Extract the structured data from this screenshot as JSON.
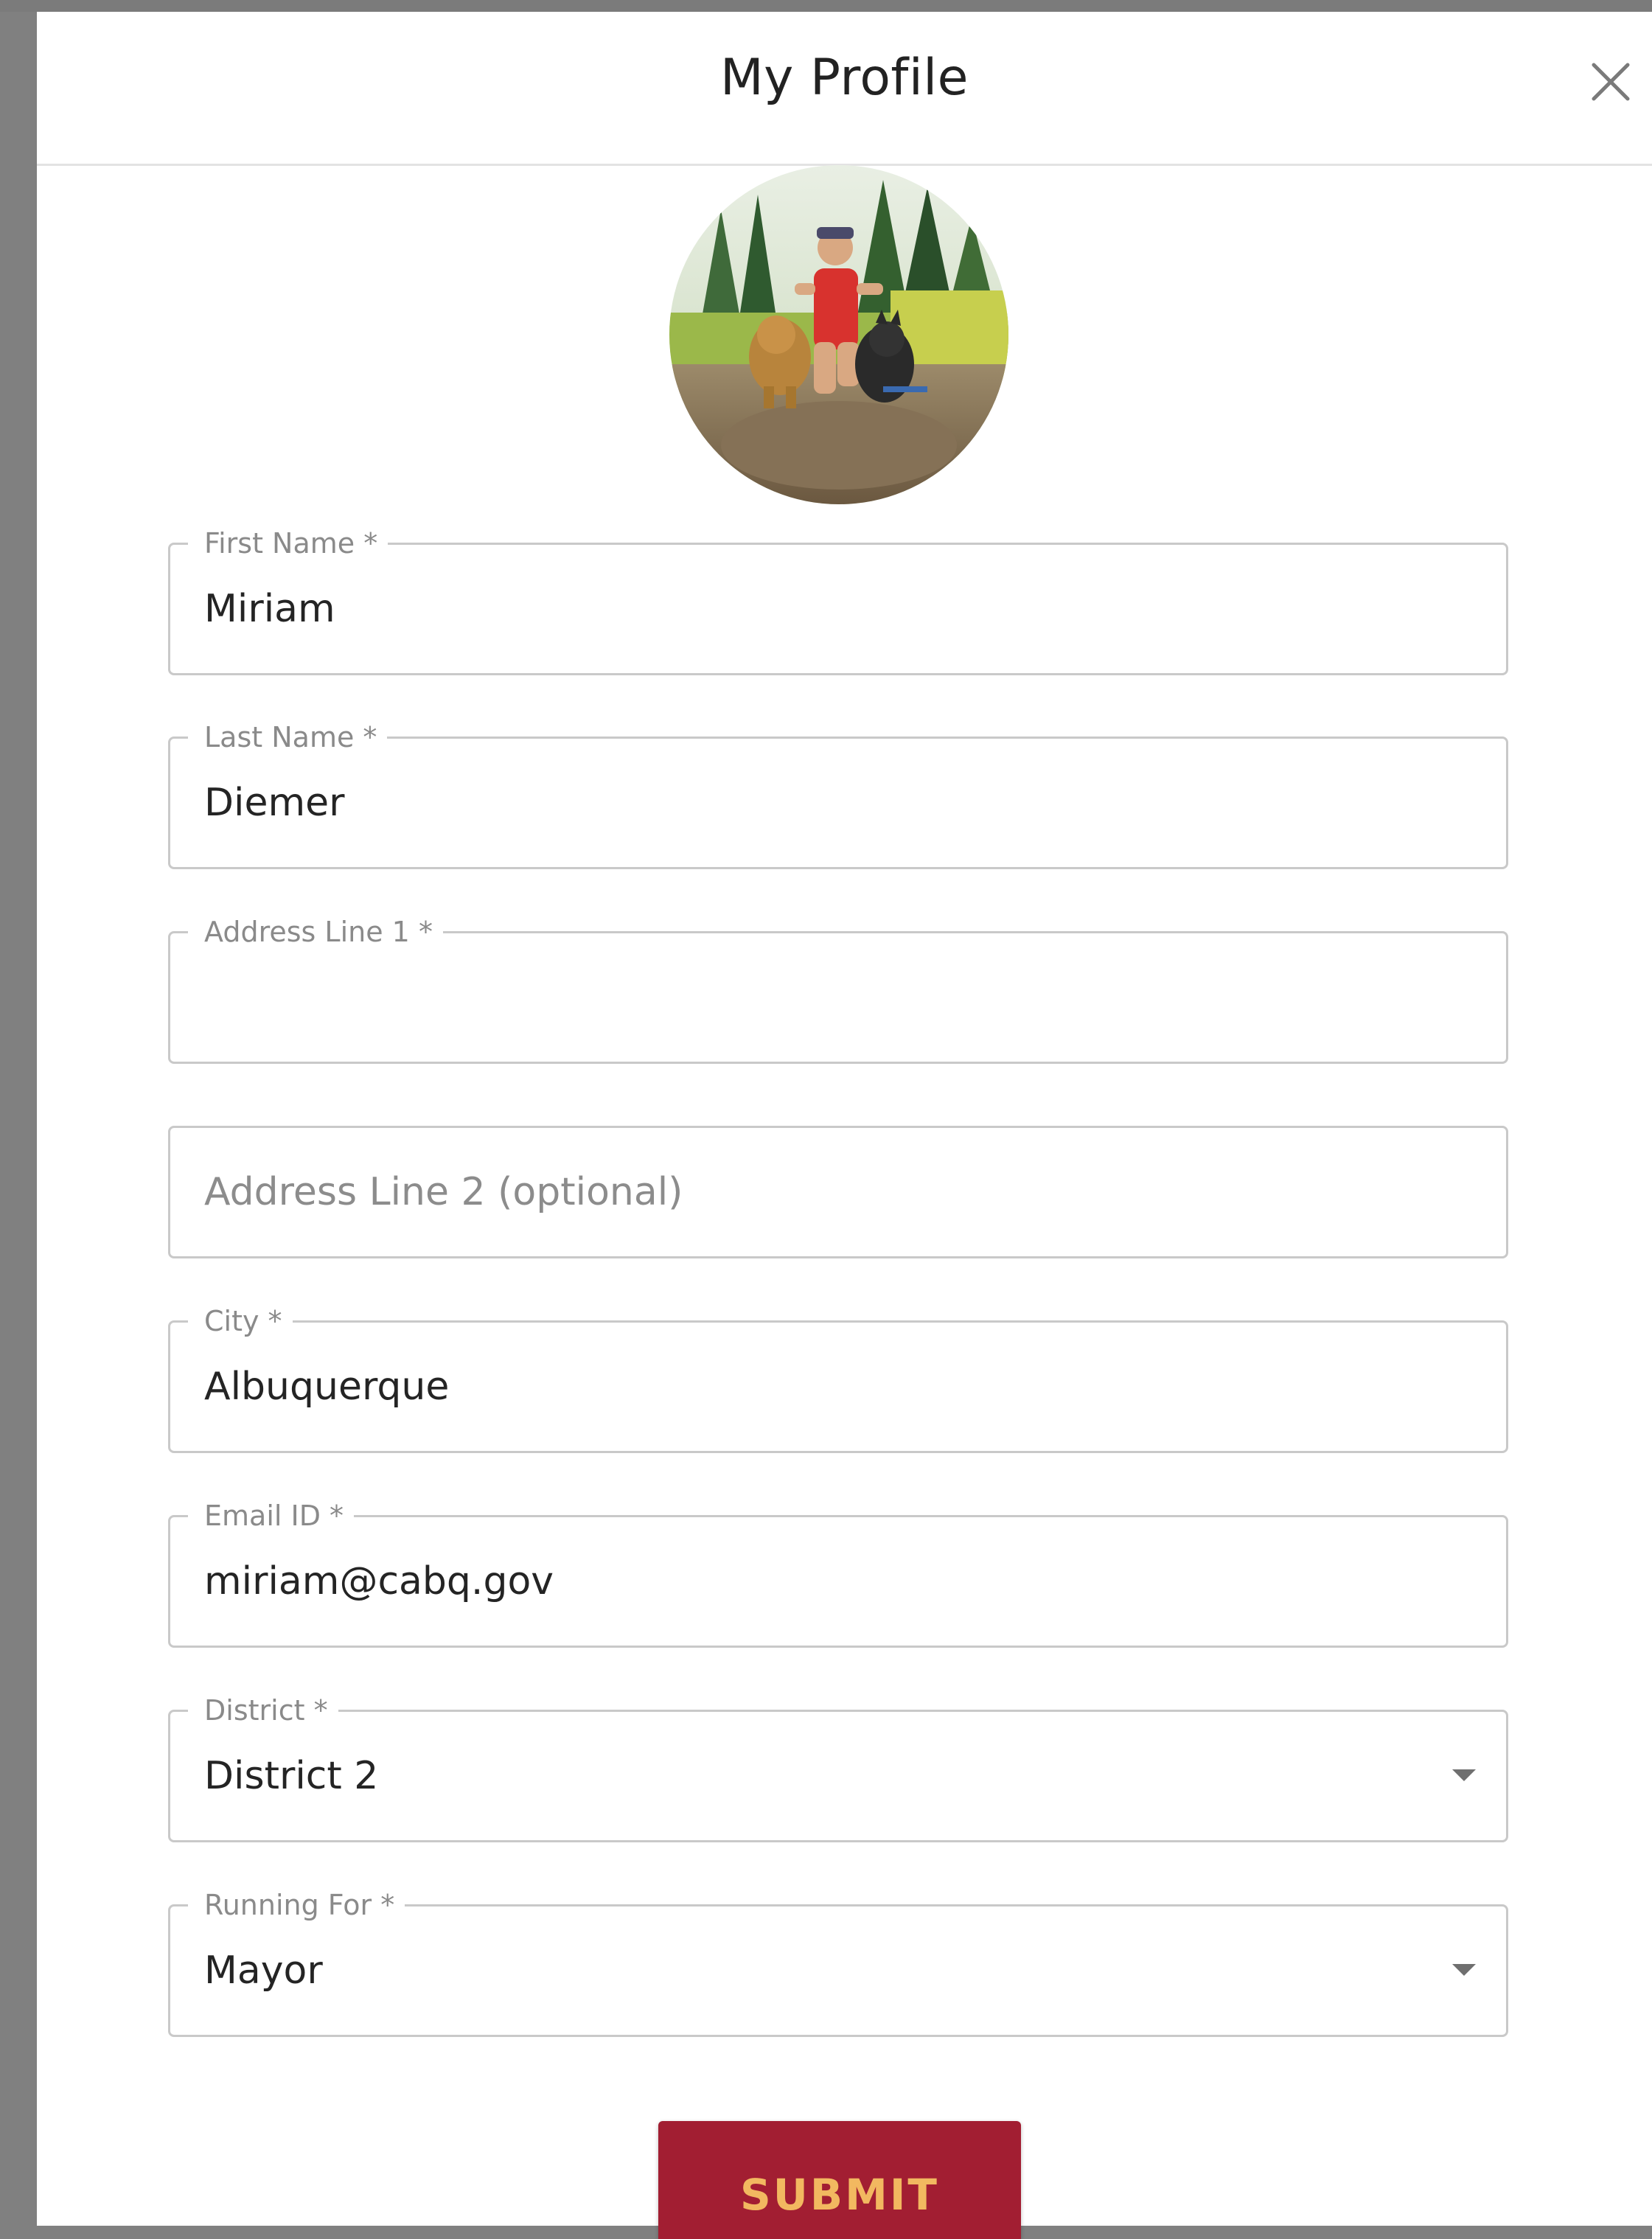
{
  "modal": {
    "title": "My Profile",
    "close_icon": "close-icon"
  },
  "avatar": {
    "icon": "profile-photo"
  },
  "form": {
    "first_name": {
      "label": "First Name *",
      "value": "Miriam"
    },
    "last_name": {
      "label": "Last Name *",
      "value": "Diemer"
    },
    "address_line_1": {
      "label": "Address Line 1 *",
      "value": ""
    },
    "address_line_2": {
      "placeholder": "Address Line 2 (optional)",
      "value": ""
    },
    "city": {
      "label": "City *",
      "value": "Albuquerque"
    },
    "email": {
      "label": "Email ID *",
      "value": "miriam@cabq.gov"
    },
    "district": {
      "label": "District *",
      "value": "District 2"
    },
    "running_for": {
      "label": "Running For *",
      "value": "Mayor"
    }
  },
  "submit": {
    "label": "SUBMIT"
  },
  "colors": {
    "submit_background": "#a21e32",
    "submit_text": "#f2b860",
    "backdrop": "#808080"
  }
}
